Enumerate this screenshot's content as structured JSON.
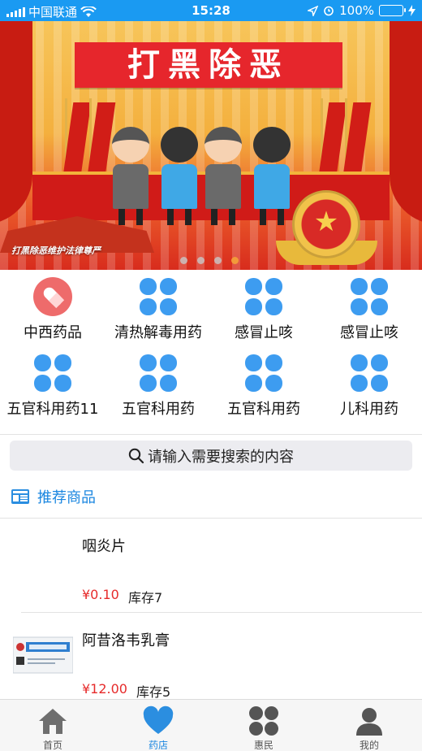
{
  "status_bar": {
    "carrier": "中国联通",
    "time": "15:28",
    "battery": "100%"
  },
  "banner": {
    "title": "打黑除恶",
    "caption": "打黑除恶维护法律尊严",
    "slide_count": 4,
    "active_slide": 4
  },
  "categories": [
    {
      "label": "中西药品",
      "icon": "pill-icon"
    },
    {
      "label": "清热解毒用药",
      "icon": "clover-icon"
    },
    {
      "label": "感冒止咳",
      "icon": "clover-icon"
    },
    {
      "label": "感冒止咳",
      "icon": "clover-icon"
    },
    {
      "label": "五官科用药11",
      "icon": "clover-icon"
    },
    {
      "label": "五官科用药",
      "icon": "clover-icon"
    },
    {
      "label": "五官科用药",
      "icon": "clover-icon"
    },
    {
      "label": "儿科用药",
      "icon": "clover-icon"
    }
  ],
  "search": {
    "placeholder": "请输入需要搜索的内容"
  },
  "recommend": {
    "title": "推荐商品"
  },
  "products": [
    {
      "name": "咽炎片",
      "price": "¥0.10",
      "stock": "库存7"
    },
    {
      "name": "阿昔洛韦乳膏",
      "price": "¥12.00",
      "stock": "库存5"
    }
  ],
  "tabs": [
    {
      "label": "首页",
      "icon": "home-icon"
    },
    {
      "label": "药店",
      "icon": "heart-icon"
    },
    {
      "label": "惠民",
      "icon": "clover-icon"
    },
    {
      "label": "我的",
      "icon": "user-icon"
    }
  ],
  "active_tab": 1,
  "colors": {
    "status_bar": "#1a9af2",
    "accent": "#1a86e0",
    "category_icon": "#3d9cf0",
    "pill_circle": "#ee6b6b",
    "price": "#e62b2b"
  }
}
